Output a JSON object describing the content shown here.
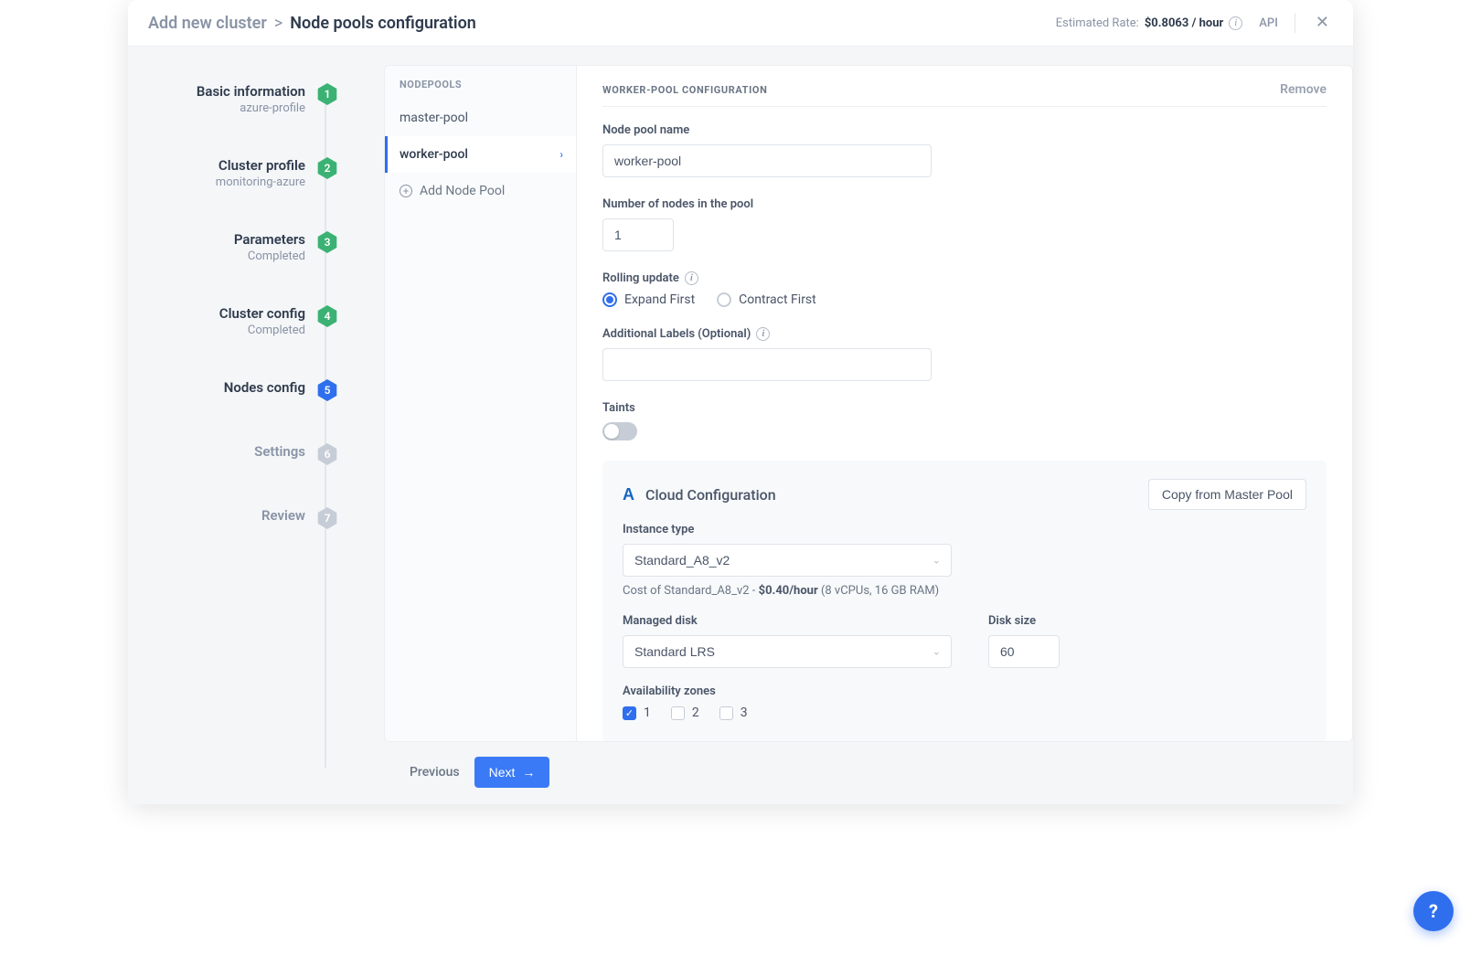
{
  "breadcrumb": {
    "root": "Add new cluster",
    "separator": ">",
    "current": "Node pools configuration"
  },
  "topbar": {
    "estimated_rate_label": "Estimated Rate:",
    "estimated_rate_value": "$0.8063 / hour",
    "api_link": "API"
  },
  "steps": [
    {
      "title": "Basic information",
      "subtitle": "azure-profile",
      "num": "1",
      "state": "done"
    },
    {
      "title": "Cluster profile",
      "subtitle": "monitoring-azure",
      "num": "2",
      "state": "done"
    },
    {
      "title": "Parameters",
      "subtitle": "Completed",
      "num": "3",
      "state": "done"
    },
    {
      "title": "Cluster config",
      "subtitle": "Completed",
      "num": "4",
      "state": "done"
    },
    {
      "title": "Nodes config",
      "subtitle": "",
      "num": "5",
      "state": "active"
    },
    {
      "title": "Settings",
      "subtitle": "",
      "num": "6",
      "state": "pending"
    },
    {
      "title": "Review",
      "subtitle": "",
      "num": "7",
      "state": "pending"
    }
  ],
  "nodepools": {
    "header": "NODEPOOLS",
    "items": [
      {
        "name": "master-pool",
        "active": false
      },
      {
        "name": "worker-pool",
        "active": true
      }
    ],
    "add_label": "Add Node Pool"
  },
  "form": {
    "section_title": "WORKER-POOL CONFIGURATION",
    "remove_label": "Remove",
    "pool_name_label": "Node pool name",
    "pool_name_value": "worker-pool",
    "num_nodes_label": "Number of nodes in the pool",
    "num_nodes_value": "1",
    "rolling_label": "Rolling update",
    "rolling_options": {
      "expand": "Expand First",
      "contract": "Contract First",
      "selected": "expand"
    },
    "labels_label": "Additional Labels (Optional)",
    "labels_value": "",
    "taints_label": "Taints",
    "taints_on": false
  },
  "cloud": {
    "title": "Cloud Configuration",
    "copy_label": "Copy from Master Pool",
    "instance_type_label": "Instance type",
    "instance_type_value": "Standard_A8_v2",
    "cost_prefix": "Cost of Standard_A8_v2 - ",
    "cost_value": "$0.40/hour",
    "cost_suffix": " (8 vCPUs, 16 GB RAM)",
    "disk_label": "Managed disk",
    "disk_value": "Standard LRS",
    "disk_size_label": "Disk size",
    "disk_size_value": "60",
    "az_label": "Availability zones",
    "az": [
      {
        "label": "1",
        "checked": true
      },
      {
        "label": "2",
        "checked": false
      },
      {
        "label": "3",
        "checked": false
      }
    ]
  },
  "footer": {
    "prev": "Previous",
    "next": "Next"
  },
  "icons": {
    "azure": "A",
    "help": "?",
    "info": "i",
    "arrow_right": "→",
    "chevron": "›",
    "close": "✕",
    "plus": "+",
    "check": "✓"
  }
}
